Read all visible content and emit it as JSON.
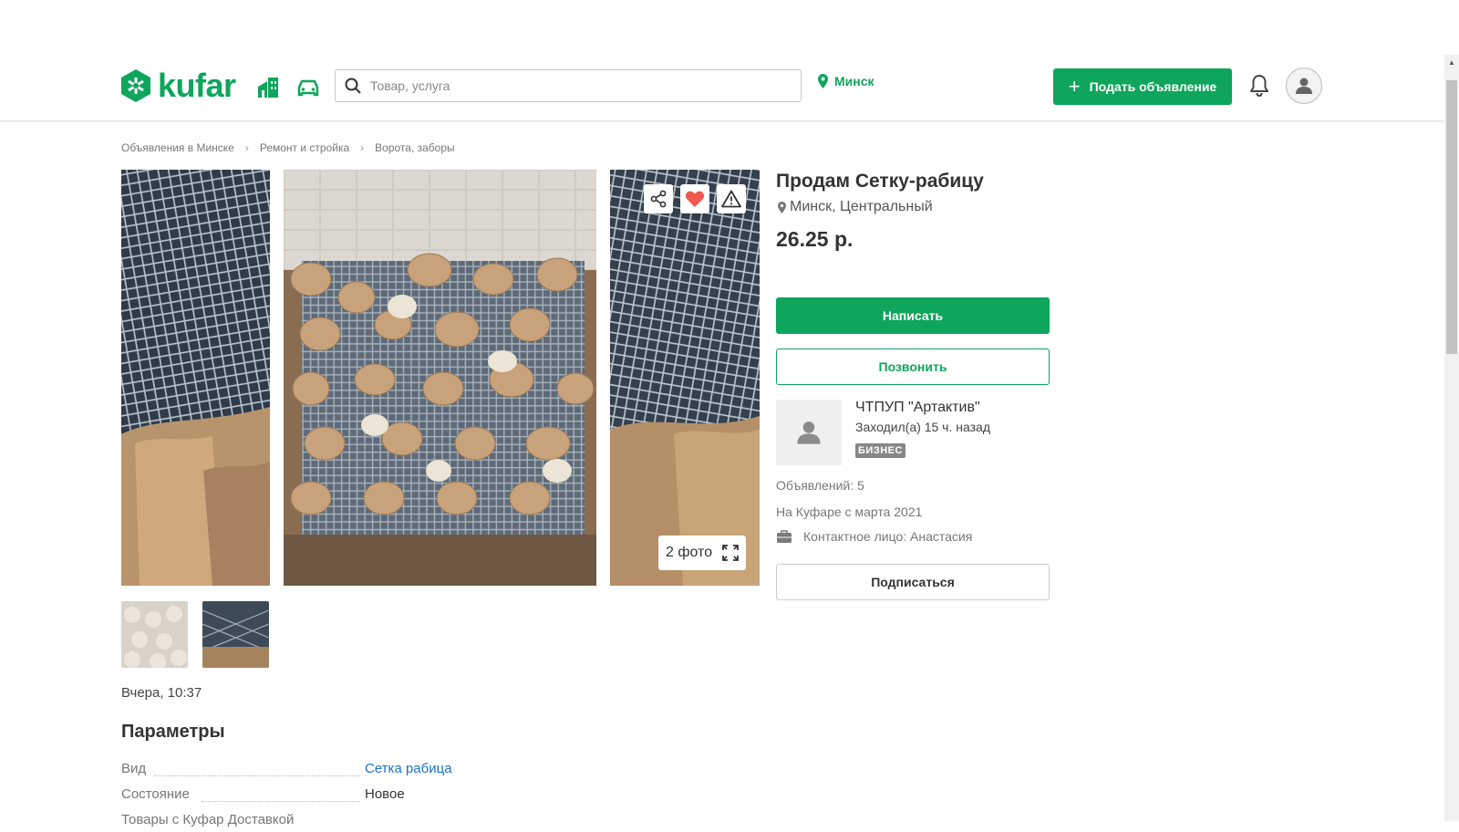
{
  "header": {
    "logo_text": "kufar",
    "search_placeholder": "Товар, услуга",
    "city": "Минск",
    "post_button": "Подать объявление"
  },
  "breadcrumbs": [
    "Объявления в Минске",
    "Ремонт и стройка",
    "Ворота, заборы"
  ],
  "gallery": {
    "photo_count": "2 фото"
  },
  "listing": {
    "title": "Продам Сетку-рабицу",
    "location": "Минск, Центральный",
    "price": "26.25 р.",
    "date": "Вчера, 10:37"
  },
  "actions": {
    "write": "Написать",
    "call": "Позвонить",
    "subscribe": "Подписаться"
  },
  "seller": {
    "name": "ЧТПУП \"Артактив\"",
    "last_seen": "Заходил(а) 15 ч. назад",
    "badge": "БИЗНЕС",
    "ads_count": "Объявлений: 5",
    "since": "На Куфаре с марта 2021",
    "contact": "Контактное лицо: Анастасия"
  },
  "params": {
    "title": "Параметры",
    "rows": [
      {
        "label": "Вид",
        "value": "Сетка рабица"
      },
      {
        "label": "Состояние",
        "value": "Новое"
      },
      {
        "label": "Товары с Куфар Доставкой",
        "value": ""
      }
    ]
  },
  "colors": {
    "brand": "#0ea55c",
    "link": "#1a73c8",
    "badge": "#878787",
    "heart": "#f0584f"
  }
}
